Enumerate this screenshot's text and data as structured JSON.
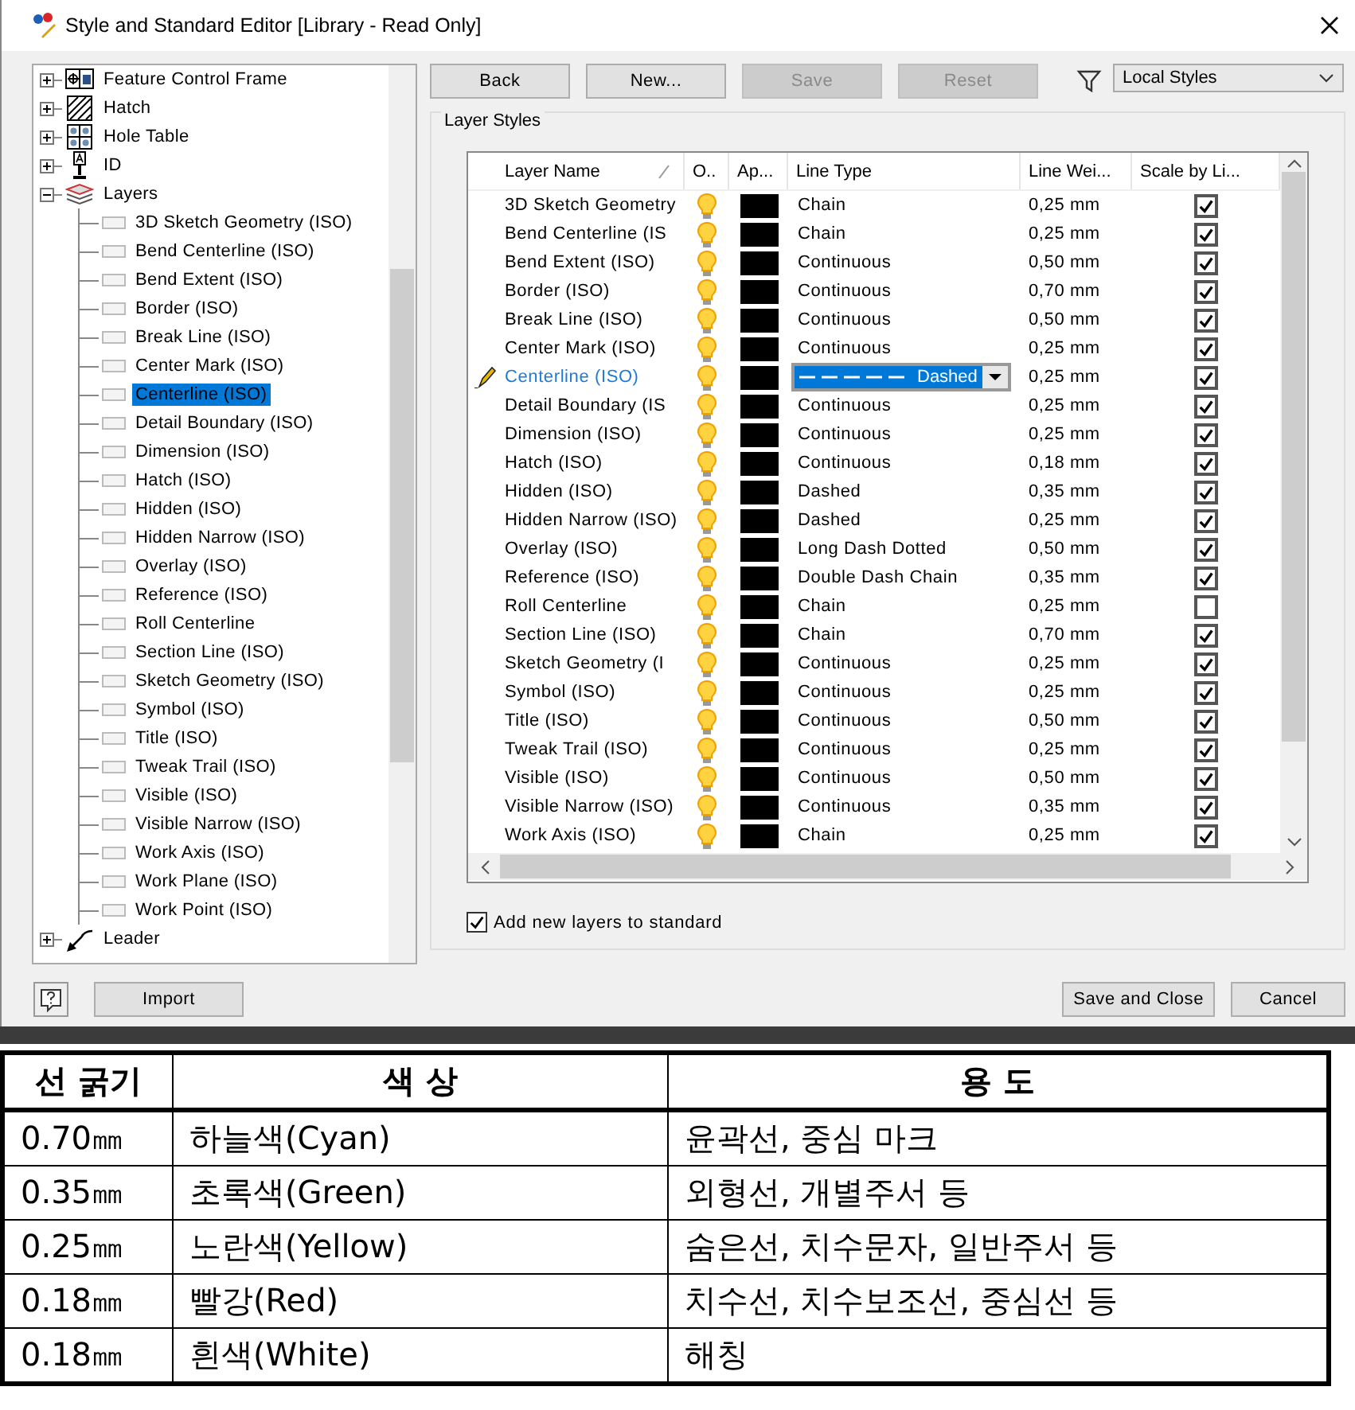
{
  "window": {
    "title": "Style and Standard Editor [Library - Read Only]"
  },
  "tree": {
    "items": [
      {
        "kind": "fcf",
        "label": "Feature Control Frame",
        "expanded": false,
        "selected": false
      },
      {
        "kind": "hatch",
        "label": "Hatch",
        "expanded": false,
        "selected": false
      },
      {
        "kind": "hole-table",
        "label": "Hole Table",
        "expanded": false,
        "selected": false
      },
      {
        "kind": "id",
        "label": "ID",
        "expanded": false,
        "selected": false
      },
      {
        "kind": "layers",
        "label": "Layers",
        "expanded": true,
        "selected": false,
        "children": [
          {
            "label": "3D Sketch Geometry (ISO)",
            "selected": false
          },
          {
            "label": "Bend Centerline (ISO)",
            "selected": false
          },
          {
            "label": "Bend Extent (ISO)",
            "selected": false
          },
          {
            "label": "Border (ISO)",
            "selected": false
          },
          {
            "label": "Break Line (ISO)",
            "selected": false
          },
          {
            "label": "Center Mark (ISO)",
            "selected": false
          },
          {
            "label": "Centerline (ISO)",
            "selected": true
          },
          {
            "label": "Detail Boundary (ISO)",
            "selected": false
          },
          {
            "label": "Dimension (ISO)",
            "selected": false
          },
          {
            "label": "Hatch (ISO)",
            "selected": false
          },
          {
            "label": "Hidden (ISO)",
            "selected": false
          },
          {
            "label": "Hidden Narrow (ISO)",
            "selected": false
          },
          {
            "label": "Overlay (ISO)",
            "selected": false
          },
          {
            "label": "Reference (ISO)",
            "selected": false
          },
          {
            "label": "Roll Centerline",
            "selected": false
          },
          {
            "label": "Section Line (ISO)",
            "selected": false
          },
          {
            "label": "Sketch Geometry (ISO)",
            "selected": false
          },
          {
            "label": "Symbol (ISO)",
            "selected": false
          },
          {
            "label": "Title (ISO)",
            "selected": false
          },
          {
            "label": "Tweak Trail (ISO)",
            "selected": false
          },
          {
            "label": "Visible (ISO)",
            "selected": false
          },
          {
            "label": "Visible Narrow (ISO)",
            "selected": false
          },
          {
            "label": "Work Axis (ISO)",
            "selected": false
          },
          {
            "label": "Work Plane (ISO)",
            "selected": false
          },
          {
            "label": "Work Point (ISO)",
            "selected": false
          }
        ]
      },
      {
        "kind": "leader",
        "label": "Leader",
        "expanded": false,
        "selected": false
      }
    ]
  },
  "toolbar": {
    "buttons": [
      {
        "label": "Back",
        "disabled": false
      },
      {
        "label": "New...",
        "disabled": false
      },
      {
        "label": "Save",
        "disabled": true
      },
      {
        "label": "Reset",
        "disabled": true
      }
    ],
    "filter": {
      "value": "Local Styles"
    }
  },
  "group": {
    "title": "Layer Styles",
    "columns": [
      "Layer Name",
      "O..",
      "Ap...",
      "Line Type",
      "Line Wei...",
      "Scale by Li..."
    ],
    "rows": [
      {
        "name": "3D Sketch Geometry",
        "on": true,
        "color": "#000000",
        "line_type": "Chain",
        "line_weight": "0,25 mm",
        "scale": true,
        "selected": false
      },
      {
        "name": "Bend Centerline (IS",
        "on": true,
        "color": "#000000",
        "line_type": "Chain",
        "line_weight": "0,25 mm",
        "scale": true,
        "selected": false
      },
      {
        "name": "Bend Extent (ISO)",
        "on": true,
        "color": "#000000",
        "line_type": "Continuous",
        "line_weight": "0,50 mm",
        "scale": true,
        "selected": false
      },
      {
        "name": "Border (ISO)",
        "on": true,
        "color": "#000000",
        "line_type": "Continuous",
        "line_weight": "0,70 mm",
        "scale": true,
        "selected": false
      },
      {
        "name": "Break Line (ISO)",
        "on": true,
        "color": "#000000",
        "line_type": "Continuous",
        "line_weight": "0,50 mm",
        "scale": true,
        "selected": false
      },
      {
        "name": "Center Mark (ISO)",
        "on": true,
        "color": "#000000",
        "line_type": "Continuous",
        "line_weight": "0,25 mm",
        "scale": true,
        "selected": false
      },
      {
        "name": "Centerline (ISO)",
        "on": true,
        "color": "#000000",
        "line_type": "Dashed",
        "line_weight": "0,25 mm",
        "scale": true,
        "selected": true
      },
      {
        "name": "Detail Boundary (IS",
        "on": true,
        "color": "#000000",
        "line_type": "Continuous",
        "line_weight": "0,25 mm",
        "scale": true,
        "selected": false
      },
      {
        "name": "Dimension (ISO)",
        "on": true,
        "color": "#000000",
        "line_type": "Continuous",
        "line_weight": "0,25 mm",
        "scale": true,
        "selected": false
      },
      {
        "name": "Hatch (ISO)",
        "on": true,
        "color": "#000000",
        "line_type": "Continuous",
        "line_weight": "0,18 mm",
        "scale": true,
        "selected": false
      },
      {
        "name": "Hidden (ISO)",
        "on": true,
        "color": "#000000",
        "line_type": "Dashed",
        "line_weight": "0,35 mm",
        "scale": true,
        "selected": false
      },
      {
        "name": "Hidden Narrow (ISO)",
        "on": true,
        "color": "#000000",
        "line_type": "Dashed",
        "line_weight": "0,25 mm",
        "scale": true,
        "selected": false
      },
      {
        "name": "Overlay (ISO)",
        "on": true,
        "color": "#000000",
        "line_type": "Long Dash Dotted",
        "line_weight": "0,50 mm",
        "scale": true,
        "selected": false
      },
      {
        "name": "Reference (ISO)",
        "on": true,
        "color": "#000000",
        "line_type": "Double Dash Chain",
        "line_weight": "0,35 mm",
        "scale": true,
        "selected": false
      },
      {
        "name": "Roll Centerline",
        "on": true,
        "color": "#000000",
        "line_type": "Chain",
        "line_weight": "0,25 mm",
        "scale": false,
        "selected": false
      },
      {
        "name": "Section Line (ISO)",
        "on": true,
        "color": "#000000",
        "line_type": "Chain",
        "line_weight": "0,70 mm",
        "scale": true,
        "selected": false
      },
      {
        "name": "Sketch Geometry (I",
        "on": true,
        "color": "#000000",
        "line_type": "Continuous",
        "line_weight": "0,25 mm",
        "scale": true,
        "selected": false
      },
      {
        "name": "Symbol (ISO)",
        "on": true,
        "color": "#000000",
        "line_type": "Continuous",
        "line_weight": "0,25 mm",
        "scale": true,
        "selected": false
      },
      {
        "name": "Title (ISO)",
        "on": true,
        "color": "#000000",
        "line_type": "Continuous",
        "line_weight": "0,50 mm",
        "scale": true,
        "selected": false
      },
      {
        "name": "Tweak Trail (ISO)",
        "on": true,
        "color": "#000000",
        "line_type": "Continuous",
        "line_weight": "0,25 mm",
        "scale": true,
        "selected": false
      },
      {
        "name": "Visible (ISO)",
        "on": true,
        "color": "#000000",
        "line_type": "Continuous",
        "line_weight": "0,50 mm",
        "scale": true,
        "selected": false
      },
      {
        "name": "Visible Narrow (ISO)",
        "on": true,
        "color": "#000000",
        "line_type": "Continuous",
        "line_weight": "0,35 mm",
        "scale": true,
        "selected": false
      },
      {
        "name": "Work Axis (ISO)",
        "on": true,
        "color": "#000000",
        "line_type": "Chain",
        "line_weight": "0,25 mm",
        "scale": true,
        "selected": false
      }
    ],
    "add_new": {
      "label": "Add new layers to standard",
      "checked": true
    }
  },
  "footer": {
    "left": "Import",
    "buttons": [
      "Save and Close",
      "Cancel"
    ]
  },
  "reference_table": {
    "columns": [
      "선 굵기",
      "색 상",
      "용 도"
    ],
    "rows": [
      [
        "0.70㎜",
        "하늘색(Cyan)",
        "윤곽선, 중심 마크"
      ],
      [
        "0.35㎜",
        "초록색(Green)",
        "외형선, 개별주서 등"
      ],
      [
        "0.25㎜",
        "노란색(Yellow)",
        "숨은선, 치수문자, 일반주서 등"
      ],
      [
        "0.18㎜",
        "빨강(Red)",
        "치수선, 치수보조선, 중심선 등"
      ],
      [
        "0.18㎜",
        "흰색(White)",
        "해칭"
      ]
    ]
  }
}
